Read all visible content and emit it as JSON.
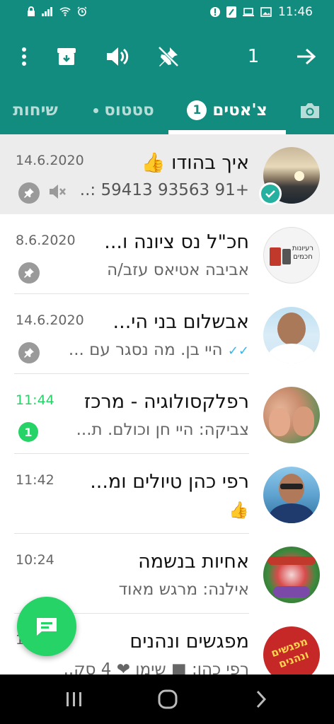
{
  "status_bar": {
    "time": "11:46"
  },
  "toolbar": {
    "selected_count": "1"
  },
  "tabs": {
    "chats": "צ'אטים",
    "chats_badge": "1",
    "status": "סטטוס",
    "calls": "שיחות"
  },
  "chats": [
    {
      "name": "איך בהודו",
      "name_emoji": "👍",
      "time": "14.6.2020",
      "message": "+91 93563 59413 :..",
      "pinned": true,
      "muted": true,
      "selected": true
    },
    {
      "name": "חכ\"ל נס ציונה ו...",
      "time": "8.6.2020",
      "message": "אביבה אטיאס עזב/ה",
      "pinned": true,
      "avatar_text": "רעיונות חכמים"
    },
    {
      "name": "אבשלום בני הי...",
      "time": "14.6.2020",
      "message": "היי בן. מה נסגר עם ...",
      "pinned": true,
      "read_ticks": "✓✓"
    },
    {
      "name": "רפלקסולוגיה - מרכז",
      "time": "11:44",
      "message": "צביקה: היי חן וכולם. ת...",
      "unread": "1"
    },
    {
      "name": "רפי כהן טיולים ומ...",
      "time": "11:42",
      "message": "👍"
    },
    {
      "name": "אחיות בנשמה",
      "time": "10:24",
      "message": "אילנה: מרגש מאוד"
    },
    {
      "name": "מפגשים ונהנים",
      "time": "1",
      "message": "רפי כהן: ■ שימו ❤ 4 סק...",
      "avatar_text": "מפגשים ונהנים"
    }
  ],
  "colors": {
    "header": "#128c7e",
    "accent": "#25d366"
  }
}
